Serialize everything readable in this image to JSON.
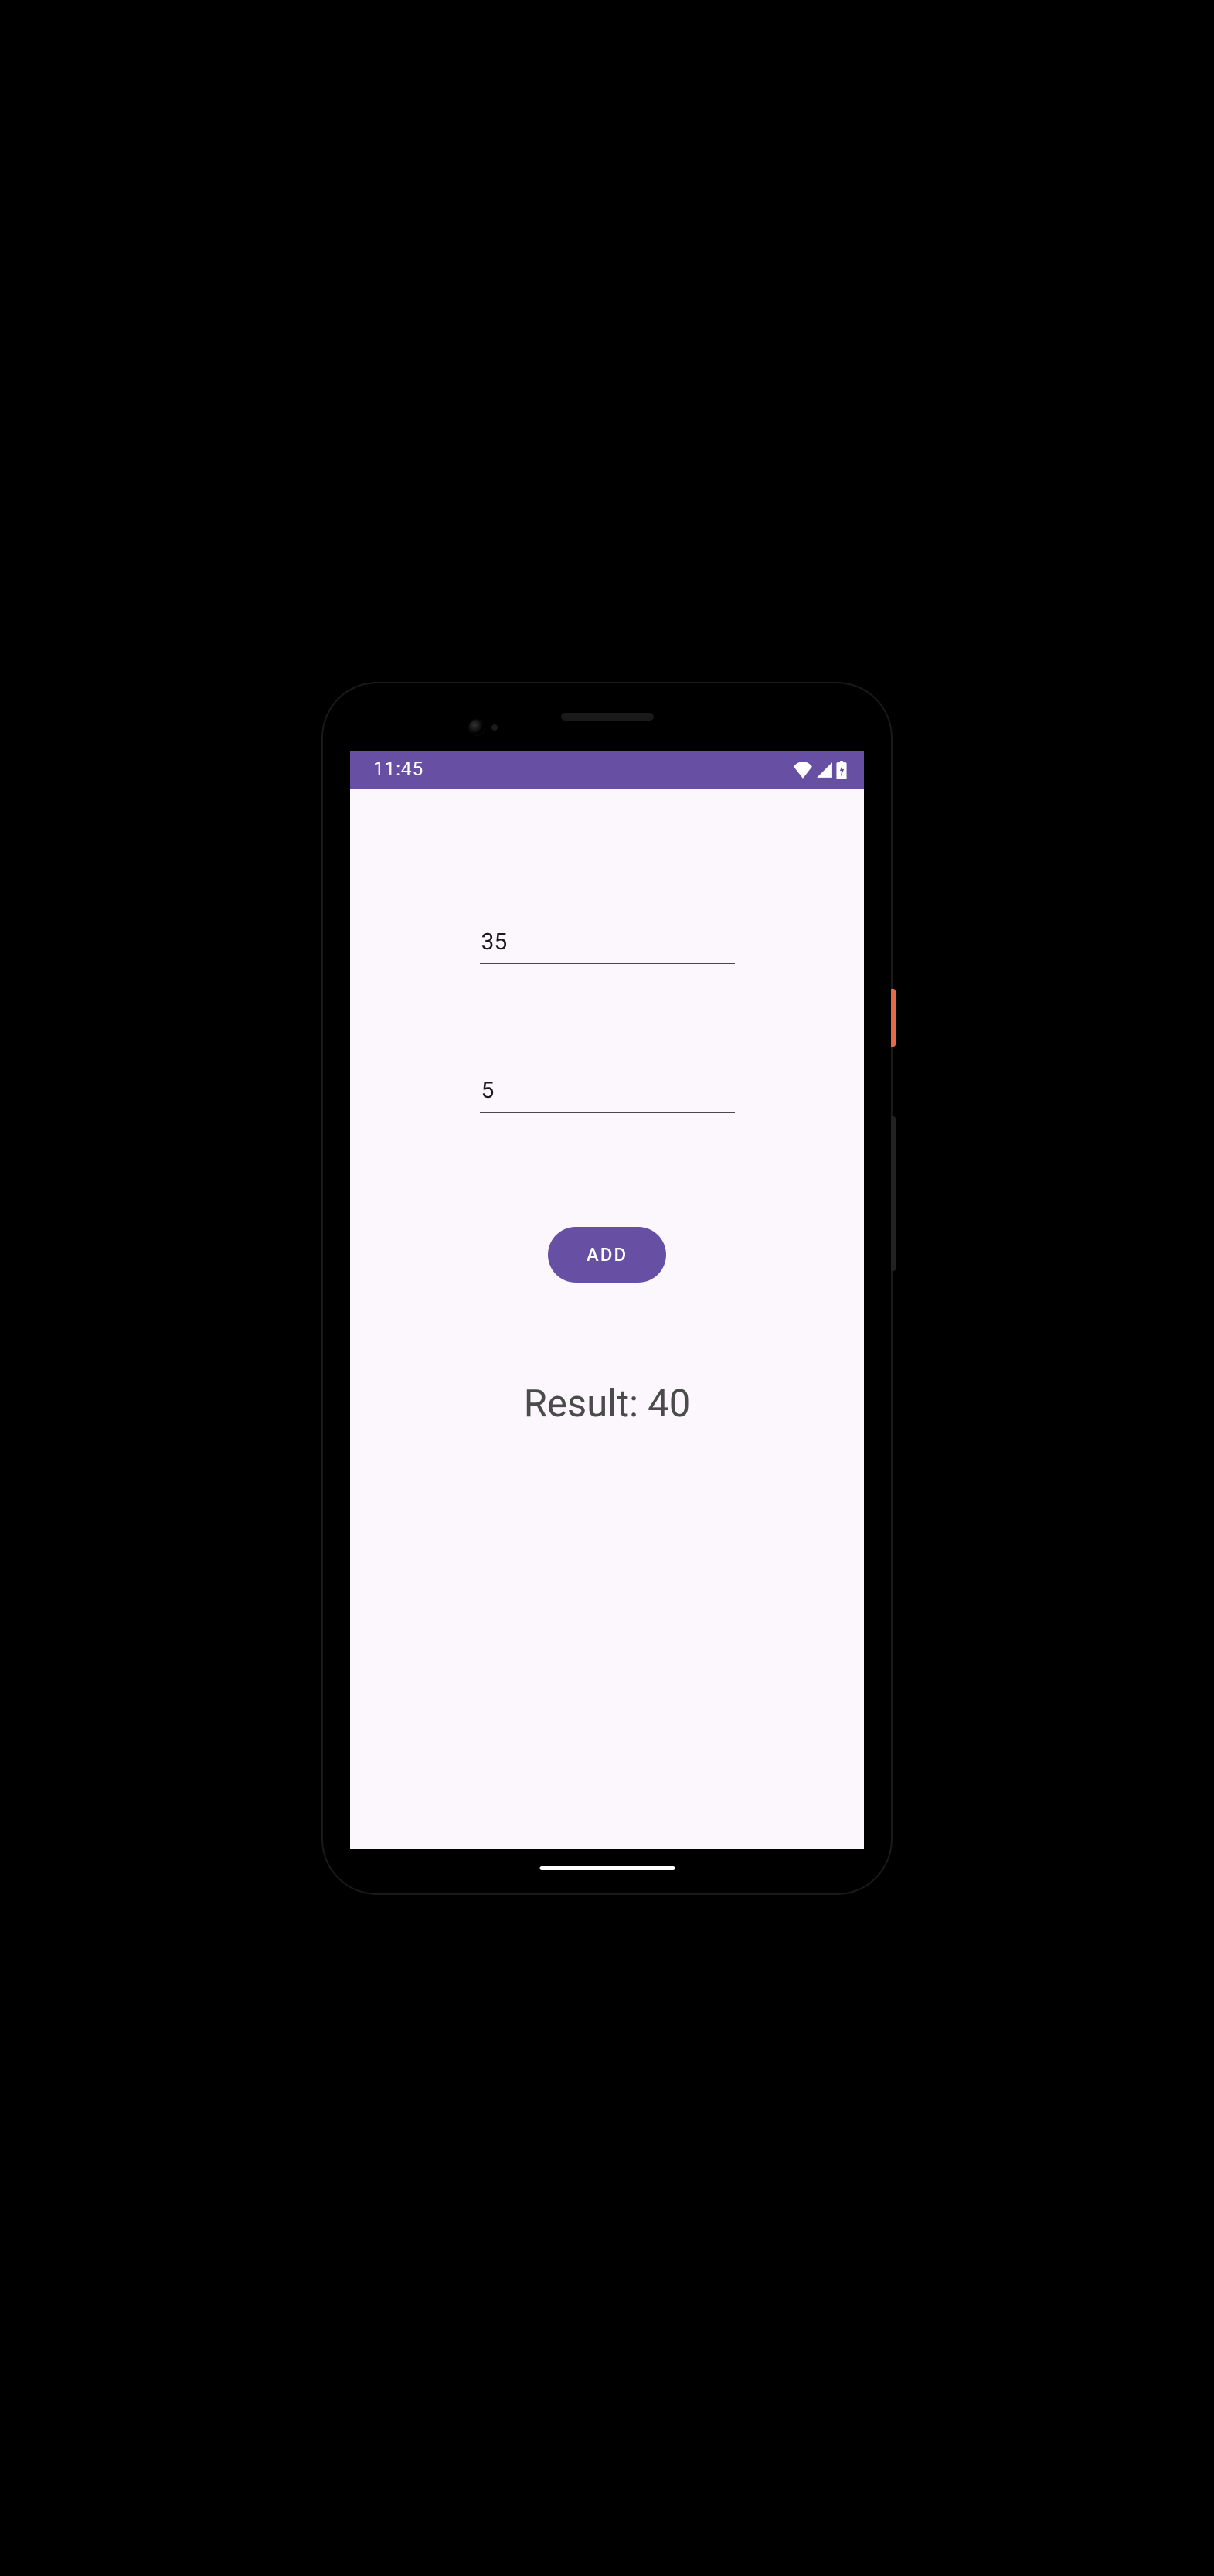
{
  "status": {
    "time": "11:45"
  },
  "inputs": {
    "first": "35",
    "second": "5"
  },
  "button": {
    "add_label": "ADD"
  },
  "result": {
    "text": "Result: 40"
  },
  "colors": {
    "primary": "#6750a3",
    "background": "#fbf7fc"
  }
}
